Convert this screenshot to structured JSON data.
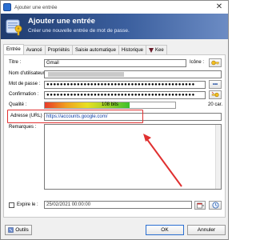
{
  "window": {
    "title": "Ajouter une entrée",
    "close_glyph": "✕"
  },
  "banner": {
    "title": "Ajouter une entrée",
    "subtitle": "Créer une nouvelle entrée de mot de passe.",
    "icon": "keepass-key-icon"
  },
  "tabs": [
    {
      "label": "Entrée",
      "active": true
    },
    {
      "label": "Avancé",
      "active": false
    },
    {
      "label": "Propriétés",
      "active": false
    },
    {
      "label": "Saisie automatique",
      "active": false
    },
    {
      "label": "Historique",
      "active": false
    },
    {
      "label": "Kee",
      "active": false
    }
  ],
  "form": {
    "title_label": "Titre :",
    "title_value": "Gmail",
    "icon_label": "Icône :",
    "username_label": "Nom d'utilisateur :",
    "username_value": "",
    "password_label": "Mot de passe :",
    "password_value": "●●●●●●●●●●●●●●●●●●●●●●●●●●●●●●●●●●●●●●●●●●●●",
    "confirm_label": "Confirmation :",
    "confirm_value": "●●●●●●●●●●●●●●●●●●●●●●●●●●●●●●●●●●●●●●●●●●●●",
    "reveal_glyph": "•••",
    "quality_label": "Qualité :",
    "quality_text": "108 bits",
    "quality_fraction": 0.65,
    "quality_chars": "20 car.",
    "url_label": "Adresse (URL) :",
    "url_value": "https://accounts.google.com/",
    "notes_label": "Remarques :",
    "notes_value": "",
    "expires_label": "Expire le :",
    "expires_value": "25/02/2021 00:00:00"
  },
  "footer": {
    "tools_label": "Outils",
    "ok_label": "OK",
    "cancel_label": "Annuler"
  },
  "colors": {
    "highlight": "#e03030",
    "url_text": "#0b3ea8",
    "banner_dark": "#1f3b6e"
  }
}
